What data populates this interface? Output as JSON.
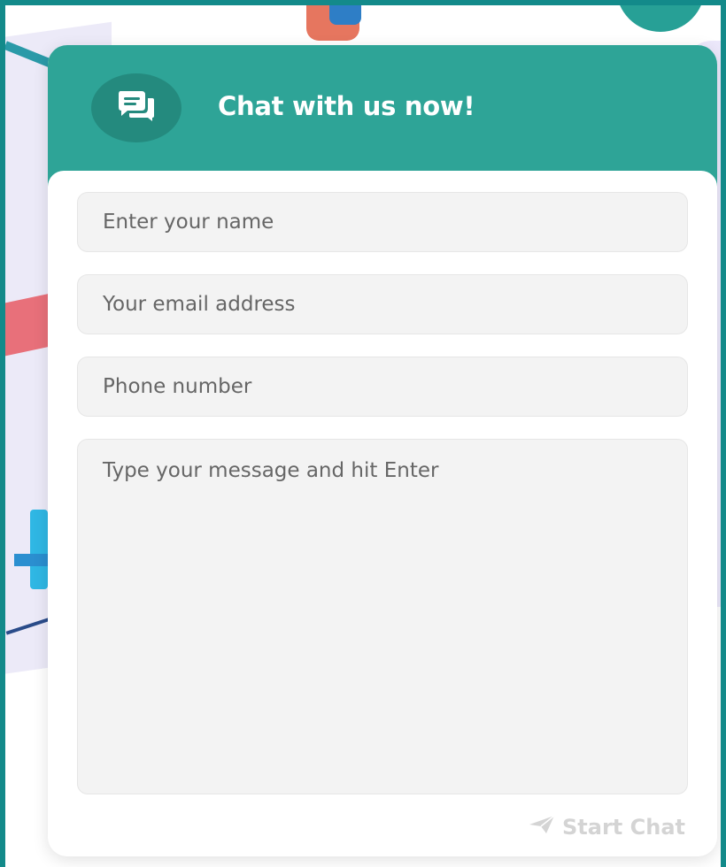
{
  "header": {
    "title": "Chat with us now!",
    "icon": "chat-bubbles-icon"
  },
  "form": {
    "name_placeholder": "Enter your name",
    "email_placeholder": "Your email address",
    "phone_placeholder": "Phone number",
    "message_placeholder": "Type your message and hit Enter"
  },
  "actions": {
    "start_chat_label": "Start Chat",
    "start_chat_icon": "paper-plane-icon"
  },
  "colors": {
    "brand_teal": "#2ea497",
    "frame_border": "#138a8a",
    "button_disabled": "#d4d4d4"
  }
}
